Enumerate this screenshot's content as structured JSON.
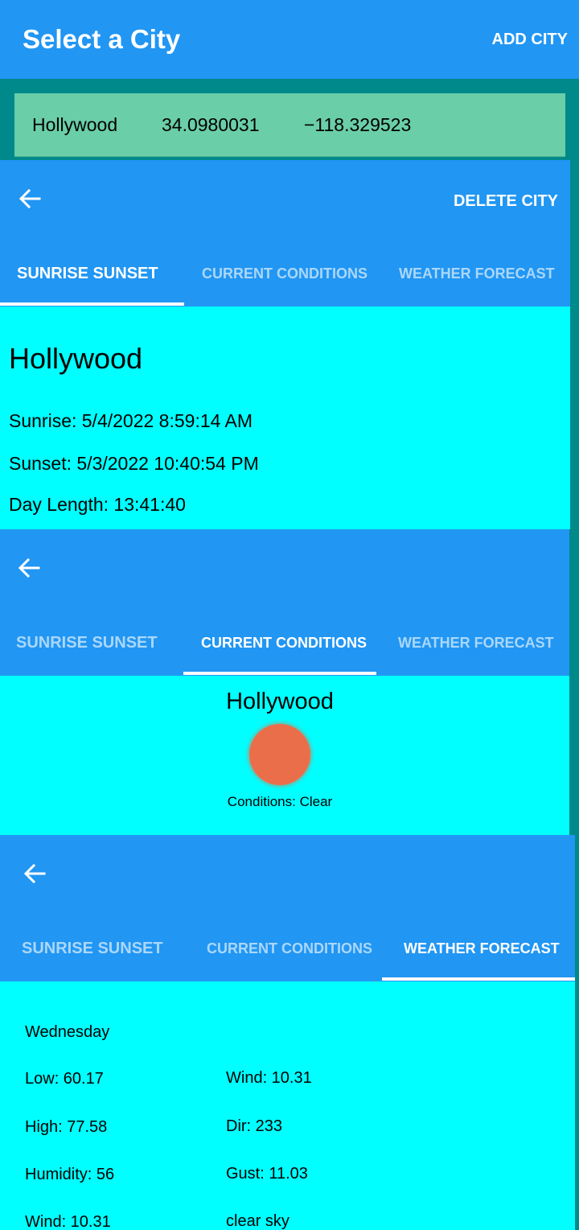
{
  "app_bar": {
    "title": "Select a City",
    "action": "ADD CITY"
  },
  "city_row": {
    "name": "Hollywood",
    "latitude": "34.0980031",
    "longitude": "−118.329523"
  },
  "panel1": {
    "action": "DELETE CITY",
    "tabs": [
      "SUNRISE SUNSET",
      "CURRENT CONDITIONS",
      "WEATHER FORECAST"
    ],
    "active_tab": "SUNRISE SUNSET",
    "city": "Hollywood",
    "sunrise": "Sunrise: 5/4/2022 8:59:14 AM",
    "sunset": "Sunset: 5/3/2022 10:40:54 PM",
    "day_length": "Day Length: 13:41:40"
  },
  "panel2": {
    "tabs": [
      "SUNRISE SUNSET",
      "CURRENT CONDITIONS",
      "WEATHER FORECAST"
    ],
    "active_tab": "CURRENT CONDITIONS",
    "city": "Hollywood",
    "conditions": "Conditions: Clear",
    "icon": "sun-icon",
    "icon_color": "#EB6E4B"
  },
  "panel3": {
    "tabs": [
      "SUNRISE SUNSET",
      "CURRENT CONDITIONS",
      "WEATHER FORECAST"
    ],
    "active_tab": "WEATHER FORECAST",
    "day": "Wednesday",
    "left_col": [
      "Low: 60.17",
      "High: 77.58",
      "Humidity: 56",
      "Wind: 10.31"
    ],
    "right_col": [
      "Wind: 10.31",
      "Dir: 233",
      "Gust: 11.03",
      "clear sky"
    ]
  },
  "colors": {
    "primary": "#2196F3",
    "background": "#00898A",
    "city_row": "#6ACEA9",
    "content": "#00FFFF"
  }
}
